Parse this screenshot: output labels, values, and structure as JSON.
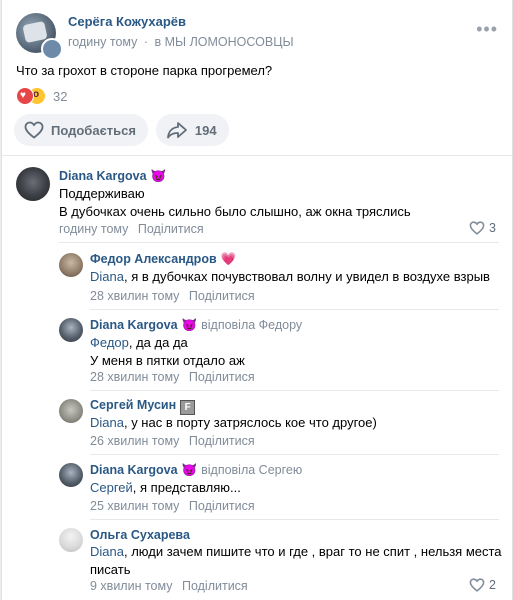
{
  "post": {
    "author": "Серёга Кожухарёв",
    "time": "годину тому",
    "separator": "·",
    "group": "в МЫ ЛОМОНОСОВЦЫ",
    "text": "Что за грохот в стороне парка прогремел?",
    "reactions_count": "32",
    "like_label": "Подобається",
    "share_count": "194"
  },
  "comments": [
    {
      "name": "Diana Kargova",
      "badge": "😈",
      "lines": [
        "Поддерживаю",
        "В дубочках очень сильно было слышно, аж окна тряслись"
      ],
      "time": "годину тому",
      "reply": "Поділитися",
      "likes": "3"
    },
    {
      "name": "Федор Александров",
      "badge": "💗",
      "addr": "Diana",
      "text": ", я в дубочках почувствовал волну и увидел в воздухе взрыв",
      "time": "28 хвилин тому",
      "reply": "Поділитися"
    },
    {
      "name": "Diana Kargova",
      "badge": "😈",
      "replied": "відповіла Федору",
      "addr": "Федор",
      "text": ", да да да",
      "line2": "У меня в пятки отдало аж",
      "time": "28 хвилин тому",
      "reply": "Поділитися"
    },
    {
      "name": "Сергей Мусин",
      "badge": "F",
      "addr": "Diana",
      "text": ", у нас в порту затряслось кое что другое)",
      "time": "26 хвилин тому",
      "reply": "Поділитися"
    },
    {
      "name": "Diana Kargova",
      "badge": "😈",
      "replied": "відповіла Сергею",
      "addr": "Сергей",
      "text": ", я представляю...",
      "time": "25 хвилин тому",
      "reply": "Поділитися"
    },
    {
      "name": "Ольга Сухарева",
      "addr": "Diana",
      "text": ", люди зачем пишите что и где , враг то не спит , нельзя места",
      "line2": "писать",
      "time": "9 хвилин тому",
      "reply": "Поділитися",
      "likes": "2"
    }
  ],
  "icons": {
    "more": "more-icon",
    "heart": "heart-outline-icon",
    "share": "share-arrow-icon",
    "like": "heart-outline-icon"
  },
  "colors": {
    "link": "#2a5885",
    "meta": "#818c99",
    "reaction_heart": "#e64646",
    "reaction_wow": "#ffc531"
  }
}
